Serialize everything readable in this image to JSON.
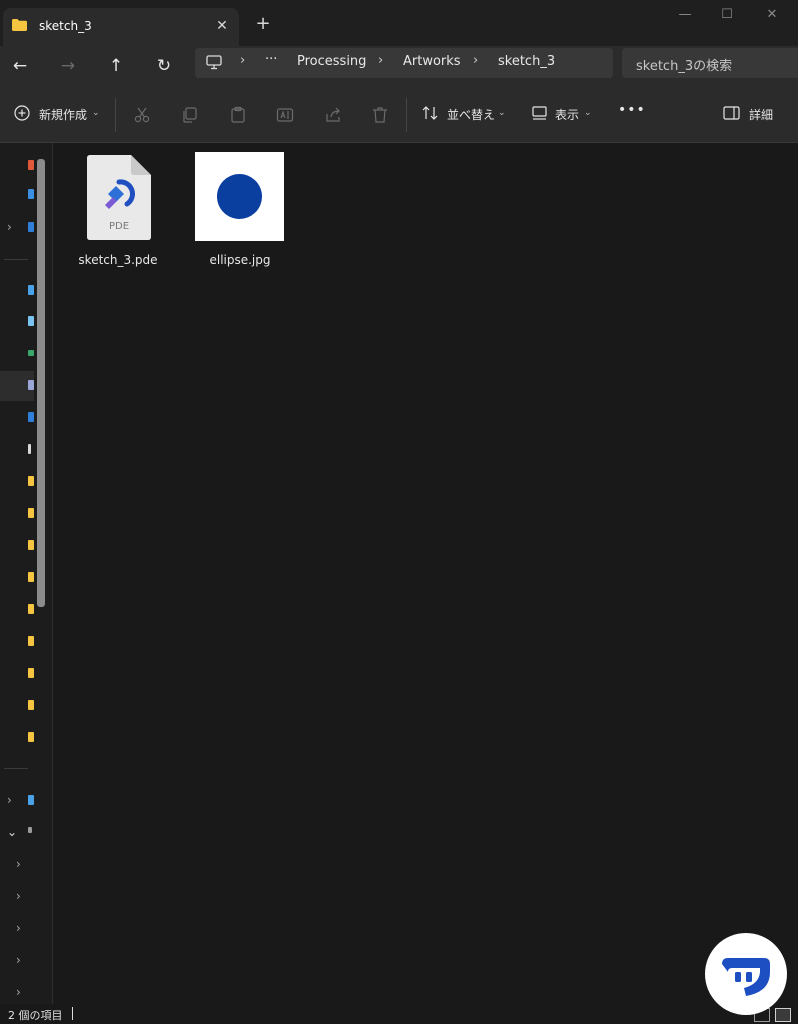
{
  "tab": {
    "title": "sketch_3",
    "close_glyph": "✕",
    "new_tab_glyph": "+"
  },
  "window_controls": {
    "minimize": "—",
    "maximize": "☐",
    "close": "✕"
  },
  "nav": {
    "back_glyph": "←",
    "forward_glyph": "→",
    "up_glyph": "↑",
    "refresh_glyph": "↻",
    "breadcrumb": [
      "Processing",
      "Artworks",
      "sketch_3"
    ],
    "more_glyph": "···",
    "separator": "›"
  },
  "search": {
    "placeholder": "sketch_3の検索"
  },
  "toolbar": {
    "new_label": "新規作成",
    "sort_label": "並べ替え",
    "view_label": "表示",
    "more_glyph": "•••",
    "details_label": "詳細"
  },
  "files": [
    {
      "name": "sketch_3.pde",
      "icon": "pde-file-icon",
      "badge": "PDE"
    },
    {
      "name": "ellipse.jpg",
      "icon": "image-thumbnail"
    }
  ],
  "colors": {
    "accent_blue": "#0a3fa0",
    "folder_yellow": "#f5c542"
  },
  "status": {
    "item_count": "2 個の項目"
  }
}
